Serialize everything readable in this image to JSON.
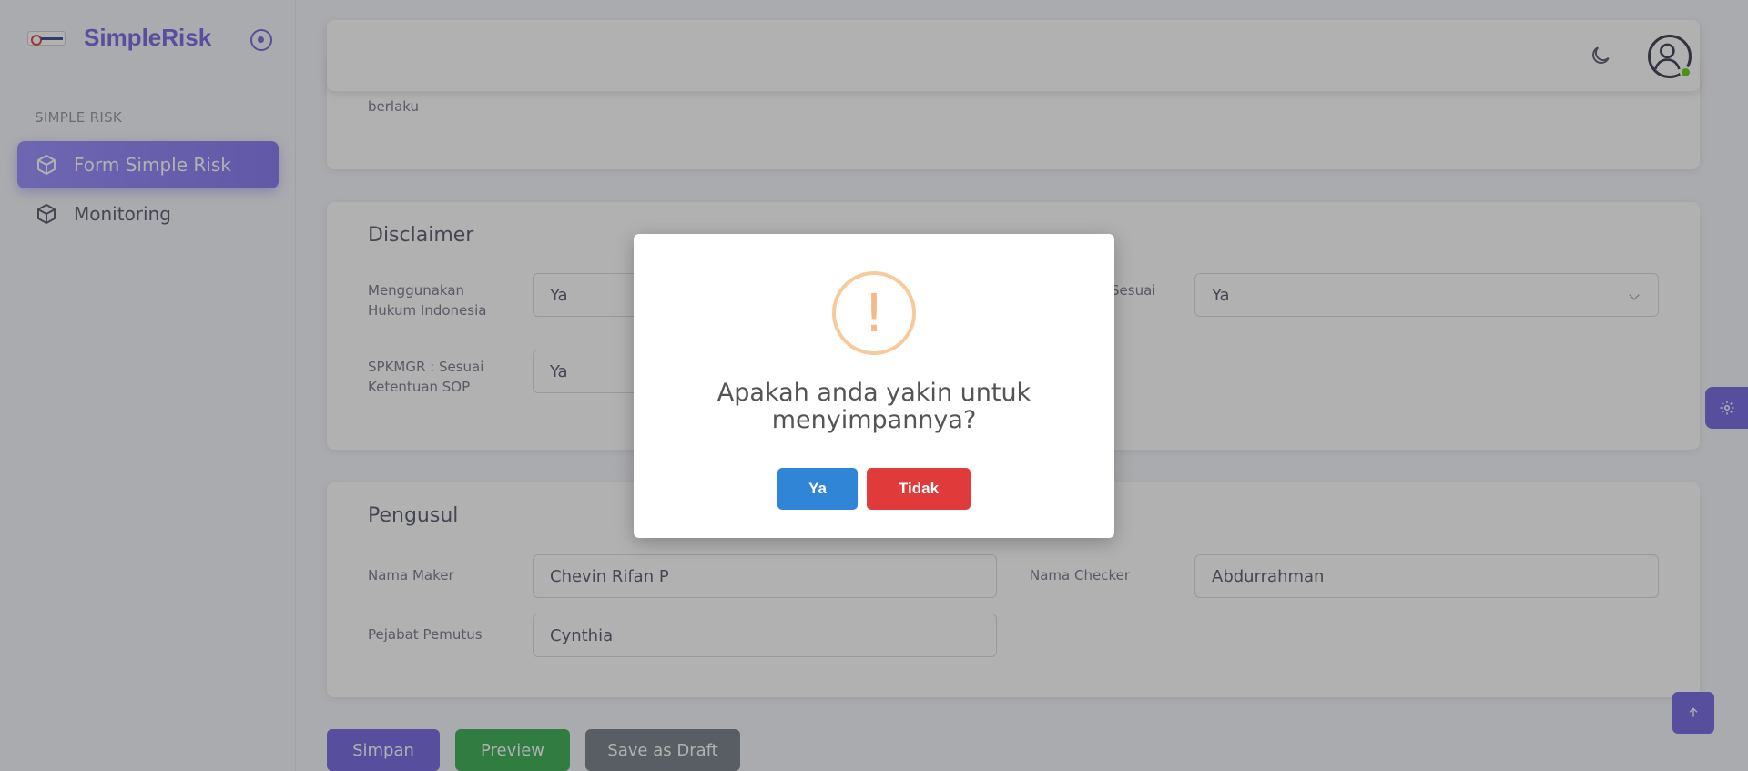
{
  "brand": {
    "name": "SimpleRisk",
    "logo_icon": "bank-logo-icon",
    "toggle_icon": "radio-circle-icon"
  },
  "sidebar": {
    "section_title": "SIMPLE RISK",
    "items": [
      {
        "label": "Form Simple Risk",
        "icon": "cube-icon",
        "active": true
      },
      {
        "label": "Monitoring",
        "icon": "cube-icon",
        "active": false
      }
    ]
  },
  "partial_card": {
    "label_fragment": "berlaku"
  },
  "disclaimer": {
    "title": "Disclaimer",
    "fields": [
      {
        "label": "Menggunakan Hukum Indonesia",
        "value": "Ya"
      },
      {
        "label_fragment": "Sesuai",
        "value": "Ya"
      },
      {
        "label": "SPKMGR : Sesuai Ketentuan SOP",
        "value": "Ya"
      }
    ]
  },
  "pengusul": {
    "title": "Pengusul",
    "fields": [
      {
        "label": "Nama Maker",
        "value": "Chevin Rifan P"
      },
      {
        "label": "Nama Checker",
        "value": "Abdurrahman"
      },
      {
        "label": "Pejabat Pemutus",
        "value": "Cynthia"
      }
    ]
  },
  "actions": {
    "simpan": "Simpan",
    "preview": "Preview",
    "save_draft": "Save as Draft"
  },
  "colors": {
    "primary": "#6a5ae0",
    "success": "#28a745",
    "secondary": "#6c757d",
    "confirm": "#3085d6",
    "cancel": "#e03a3a",
    "warning_ring": "#f8c99a"
  },
  "modal": {
    "icon_glyph": "!",
    "message": "Apakah anda yakin untuk menyimpannya?",
    "confirm_label": "Ya",
    "cancel_label": "Tidak"
  }
}
